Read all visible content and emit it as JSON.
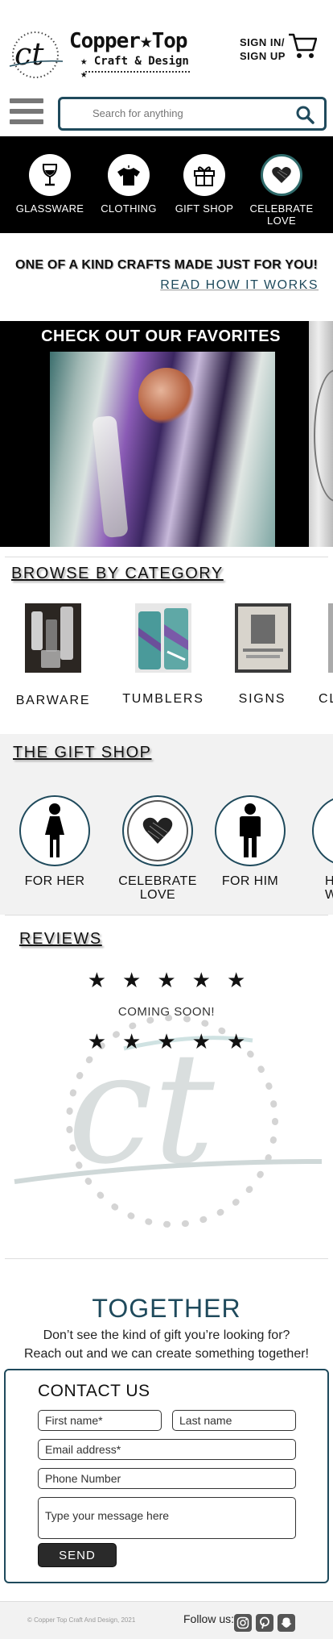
{
  "header": {
    "logo_monogram": "ct",
    "logo_name": "Copper★Top",
    "logo_sub": "★ Craft & Design ★",
    "sign_in": "SIGN IN/",
    "sign_up": "SIGN UP",
    "cart_icon": "cart-icon",
    "menu_icon": "hamburger-menu-icon"
  },
  "search": {
    "placeholder": "Search for anything",
    "value": ""
  },
  "category_nav": [
    {
      "label": "GLASSWARE",
      "icon": "wine-glass-icon"
    },
    {
      "label": "CLOTHING",
      "icon": "shirt-icon"
    },
    {
      "label": "GIFT SHOP",
      "icon": "gift-icon"
    },
    {
      "label": "CELEBRATE LOVE",
      "icon": "heart-icon"
    }
  ],
  "tagline": "ONE OF A KIND CRAFTS MADE JUST FOR YOU!",
  "read_how": "READ HOW IT WORKS",
  "favorites": {
    "title": "CHECK OUT OUR FAVORITES"
  },
  "browse": {
    "title": "BROWSE BY CATEGORY",
    "items": [
      "BARWARE",
      "TUMBLERS",
      "SIGNS",
      "CL"
    ]
  },
  "gift_shop": {
    "title": "THE GIFT SHOP",
    "items": [
      {
        "label": "FOR HER",
        "icon": "woman-icon"
      },
      {
        "label": "CELEBRATE LOVE",
        "icon": "heart-icon"
      },
      {
        "label": "FOR HIM",
        "icon": "man-icon"
      },
      {
        "label": "H WA",
        "icon": "house-icon"
      }
    ]
  },
  "reviews": {
    "title": "REVIEWS",
    "rating": 5,
    "coming_soon": "COMING SOON!"
  },
  "together": {
    "title": "TOGETHER",
    "line1": "Don’t see the kind of gift you’re looking for?",
    "line2": "Reach out and we can create something together!"
  },
  "contact": {
    "title": "CONTACT US",
    "first_name": "First name*",
    "last_name": "Last name",
    "email": "Email address*",
    "phone": "Phone Number",
    "message": "Type your message here",
    "send": "SEND"
  },
  "footer": {
    "copyright": "© Copper Top Craft And Design, 2021",
    "follow": "Follow us:",
    "social": [
      "instagram-icon",
      "pinterest-icon",
      "snapchat-icon"
    ]
  },
  "colors": {
    "teal": "#1f4a5c",
    "black": "#000000",
    "gray_bg": "#f2f2f2"
  }
}
